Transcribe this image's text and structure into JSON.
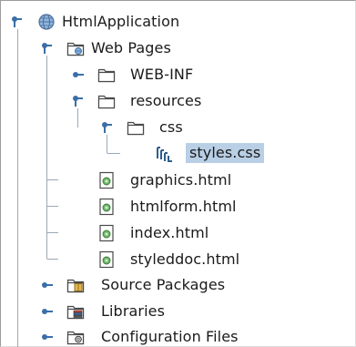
{
  "tree": {
    "root": {
      "label": "HtmlApplication",
      "icon": "globe-icon",
      "expanded": true
    },
    "web_pages": {
      "label": "Web Pages",
      "icon": "web-folder-icon",
      "expanded": true
    },
    "web_inf": {
      "label": "WEB-INF",
      "icon": "folder-icon",
      "expanded": false
    },
    "resources": {
      "label": "resources",
      "icon": "folder-icon",
      "expanded": true
    },
    "css": {
      "label": "css",
      "icon": "folder-icon",
      "expanded": true
    },
    "styles_css": {
      "label": "styles.css",
      "icon": "css-file-icon",
      "selected": true
    },
    "graphics_html": {
      "label": "graphics.html",
      "icon": "html-file-icon"
    },
    "htmlform_html": {
      "label": "htmlform.html",
      "icon": "html-file-icon"
    },
    "index_html": {
      "label": "index.html",
      "icon": "html-file-icon"
    },
    "styleddoc_html": {
      "label": "styleddoc.html",
      "icon": "html-file-icon"
    },
    "source_packages": {
      "label": "Source Packages",
      "icon": "source-packages-icon",
      "expanded": false
    },
    "libraries": {
      "label": "Libraries",
      "icon": "libraries-icon",
      "expanded": false
    },
    "configuration_files": {
      "label": "Configuration Files",
      "icon": "configuration-files-icon",
      "expanded": false
    }
  },
  "colors": {
    "selection": "#b8cfe5",
    "tree_line": "#9aa9b8",
    "toggle": "#3b6ea8",
    "folder_stroke": "#4a4a4a"
  }
}
